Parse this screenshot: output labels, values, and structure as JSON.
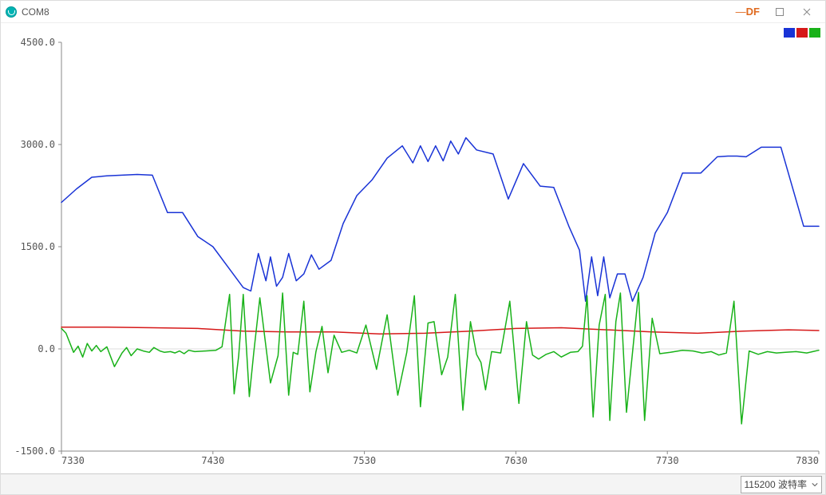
{
  "window": {
    "title": "COM8",
    "brand": "DF"
  },
  "statusbar": {
    "baud_label": "115200 波特率"
  },
  "chart_data": {
    "type": "line",
    "xlabel": "",
    "ylabel": "",
    "xlim": [
      7330,
      7830
    ],
    "ylim": [
      -1500,
      4500
    ],
    "x_ticks": [
      7330,
      7430,
      7530,
      7630,
      7730,
      7830
    ],
    "y_ticks": [
      -1500.0,
      0.0,
      1500.0,
      3000.0,
      4500.0
    ],
    "legend_colors": [
      "#1933d6",
      "#d61919",
      "#19b219"
    ],
    "series": [
      {
        "name": "blue",
        "color": "#1933d6",
        "x": [
          7330,
          7340,
          7350,
          7360,
          7370,
          7380,
          7390,
          7400,
          7410,
          7420,
          7430,
          7440,
          7450,
          7455,
          7460,
          7465,
          7468,
          7472,
          7476,
          7480,
          7485,
          7490,
          7495,
          7500,
          7508,
          7516,
          7525,
          7535,
          7545,
          7555,
          7562,
          7567,
          7572,
          7577,
          7582,
          7587,
          7592,
          7597,
          7604,
          7615,
          7625,
          7635,
          7646,
          7655,
          7665,
          7672,
          7676,
          7680,
          7684,
          7688,
          7692,
          7697,
          7702,
          7707,
          7714,
          7722,
          7730,
          7740,
          7752,
          7763,
          7770,
          7776,
          7782,
          7792,
          7805,
          7820,
          7830
        ],
        "y": [
          2150,
          2350,
          2520,
          2540,
          2550,
          2560,
          2550,
          2000,
          2000,
          1650,
          1500,
          1200,
          900,
          850,
          1400,
          1000,
          1350,
          920,
          1050,
          1400,
          1000,
          1100,
          1380,
          1170,
          1300,
          1840,
          2250,
          2480,
          2800,
          2980,
          2730,
          2980,
          2750,
          2980,
          2760,
          3050,
          2860,
          3100,
          2920,
          2860,
          2200,
          2720,
          2390,
          2370,
          1800,
          1450,
          700,
          1350,
          780,
          1350,
          750,
          1100,
          1100,
          700,
          1050,
          1700,
          2000,
          2580,
          2580,
          2820,
          2830,
          2830,
          2820,
          2960,
          2960,
          1800,
          1800
        ]
      },
      {
        "name": "red",
        "color": "#d61919",
        "x": [
          7330,
          7360,
          7390,
          7420,
          7450,
          7480,
          7510,
          7540,
          7570,
          7600,
          7630,
          7660,
          7690,
          7720,
          7750,
          7780,
          7810,
          7830
        ],
        "y": [
          320,
          320,
          310,
          300,
          260,
          250,
          250,
          220,
          230,
          260,
          300,
          310,
          280,
          250,
          230,
          260,
          280,
          270
        ]
      },
      {
        "name": "green",
        "color": "#19b219",
        "x": [
          7330,
          7333,
          7338,
          7341,
          7344,
          7347,
          7350,
          7353,
          7356,
          7360,
          7365,
          7370,
          7373,
          7376,
          7380,
          7384,
          7388,
          7391,
          7395,
          7398,
          7402,
          7405,
          7408,
          7411,
          7414,
          7418,
          7425,
          7432,
          7436,
          7441,
          7444,
          7447,
          7450,
          7454,
          7457,
          7461,
          7468,
          7473,
          7476,
          7480,
          7483,
          7486,
          7490,
          7494,
          7498,
          7502,
          7506,
          7510,
          7515,
          7520,
          7525,
          7531,
          7538,
          7545,
          7552,
          7558,
          7563,
          7567,
          7572,
          7576,
          7581,
          7585,
          7590,
          7595,
          7600,
          7604,
          7607,
          7610,
          7614,
          7620,
          7626,
          7632,
          7637,
          7641,
          7645,
          7650,
          7655,
          7660,
          7666,
          7671,
          7674,
          7677,
          7681,
          7685,
          7689,
          7692,
          7696,
          7699,
          7703,
          7707,
          7711,
          7715,
          7720,
          7725,
          7732,
          7740,
          7747,
          7753,
          7759,
          7764,
          7769,
          7774,
          7779,
          7784,
          7790,
          7796,
          7802,
          7808,
          7815,
          7822,
          7830
        ],
        "y": [
          300,
          230,
          -50,
          40,
          -120,
          80,
          -30,
          50,
          -40,
          30,
          -260,
          -60,
          20,
          -100,
          0,
          -30,
          -50,
          20,
          -30,
          -50,
          -40,
          -60,
          -30,
          -70,
          -20,
          -40,
          -30,
          -20,
          30,
          800,
          -660,
          -100,
          800,
          -700,
          -50,
          750,
          -500,
          -100,
          820,
          -680,
          -50,
          -80,
          700,
          -630,
          -40,
          330,
          -350,
          200,
          -50,
          -20,
          -60,
          350,
          -300,
          500,
          -680,
          -50,
          780,
          -850,
          380,
          400,
          -380,
          -120,
          800,
          -900,
          400,
          -80,
          -200,
          -600,
          -40,
          -60,
          700,
          -800,
          400,
          -90,
          -150,
          -80,
          -40,
          -120,
          -50,
          -40,
          40,
          780,
          -1000,
          350,
          800,
          -1050,
          400,
          820,
          -930,
          -60,
          830,
          -1050,
          450,
          -70,
          -50,
          -20,
          -30,
          -60,
          -40,
          -90,
          -60,
          700,
          -1100,
          -30,
          -80,
          -40,
          -60,
          -50,
          -40,
          -60,
          -20
        ]
      }
    ]
  }
}
